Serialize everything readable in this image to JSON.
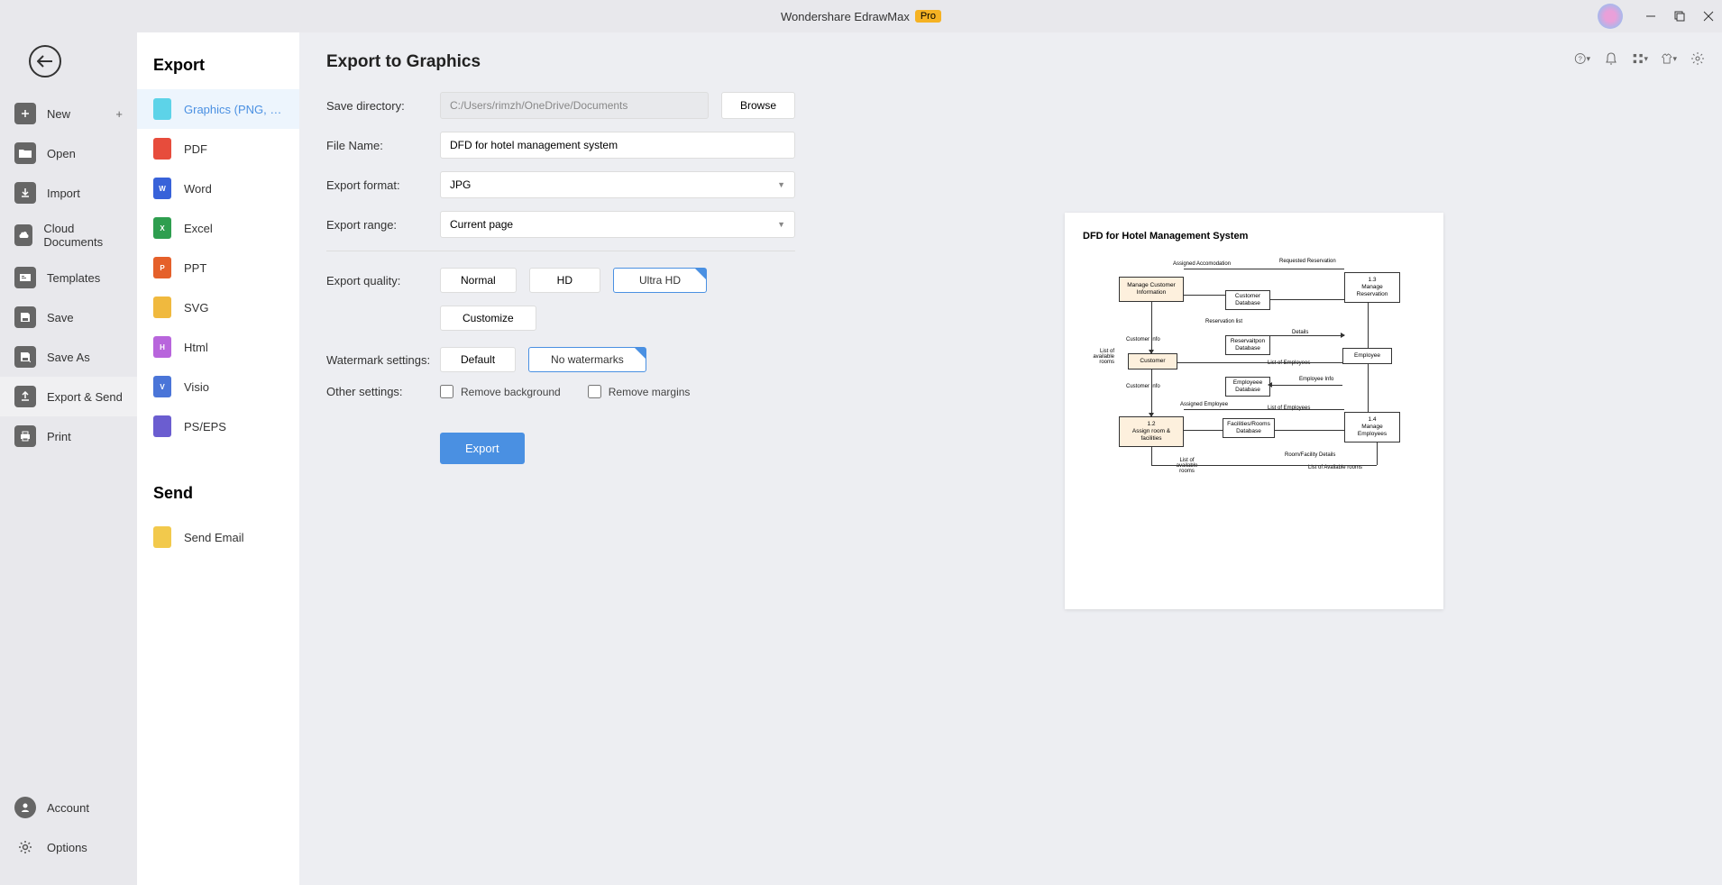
{
  "app": {
    "title": "Wondershare EdrawMax",
    "badge": "Pro"
  },
  "sidebar": {
    "items": [
      {
        "label": "New"
      },
      {
        "label": "Open"
      },
      {
        "label": "Import"
      },
      {
        "label": "Cloud Documents"
      },
      {
        "label": "Templates"
      },
      {
        "label": "Save"
      },
      {
        "label": "Save As"
      },
      {
        "label": "Export & Send"
      },
      {
        "label": "Print"
      }
    ],
    "bottom": [
      {
        "label": "Account"
      },
      {
        "label": "Options"
      }
    ]
  },
  "options_panel": {
    "export_heading": "Export",
    "export_items": [
      {
        "label": "Graphics (PNG, JPG et...",
        "color": "#5dd3e8"
      },
      {
        "label": "PDF",
        "color": "#e74c3c"
      },
      {
        "label": "Word",
        "color": "#3862d9"
      },
      {
        "label": "Excel",
        "color": "#2e9e4f"
      },
      {
        "label": "PPT",
        "color": "#e5602a"
      },
      {
        "label": "SVG",
        "color": "#f0b93e"
      },
      {
        "label": "Html",
        "color": "#b865dc"
      },
      {
        "label": "Visio",
        "color": "#4a75d8"
      },
      {
        "label": "PS/EPS",
        "color": "#6b5dd0"
      }
    ],
    "send_heading": "Send",
    "send_items": [
      {
        "label": "Send Email",
        "color": "#f2c94c"
      }
    ]
  },
  "form": {
    "title": "Export to Graphics",
    "save_dir_label": "Save directory:",
    "save_dir_value": "C:/Users/rimzh/OneDrive/Documents",
    "browse_label": "Browse",
    "filename_label": "File Name:",
    "filename_value": "DFD for hotel management system",
    "format_label": "Export format:",
    "format_value": "JPG",
    "range_label": "Export range:",
    "range_value": "Current page",
    "quality_label": "Export quality:",
    "quality_options": [
      "Normal",
      "HD",
      "Ultra HD"
    ],
    "customize_label": "Customize",
    "watermark_label": "Watermark settings:",
    "watermark_options": [
      "Default",
      "No watermarks"
    ],
    "other_label": "Other settings:",
    "remove_bg_label": "Remove background",
    "remove_margins_label": "Remove margins",
    "export_btn": "Export"
  },
  "preview": {
    "title": "DFD for Hotel Management System",
    "boxes": {
      "mci": "Manage Customer\nInformation",
      "p13": "1.3",
      "mr": "Manage\nReservation",
      "cd": "Customer\nDatabase",
      "rd": "Reservaitpon\nDatabase",
      "cust": "Customer",
      "emp": "Employee",
      "ed": "Employeee\nDatabase",
      "p12": "1.2",
      "arf": "Assign room &\nfacilities",
      "frd": "Facilities/Rooms\nDatabase",
      "p14": "1.4",
      "me": "Manage\nEmployees"
    },
    "labels": {
      "aa": "Assigned Accomodation",
      "rr": "Requested Reservation",
      "rl": "Reservation list",
      "ci1": "Customer Info",
      "ci2": "Customer Info",
      "det": "Details",
      "loe1": "List of Employees",
      "loe2": "List of Employees",
      "ei": "Employee Info",
      "ae": "Assigned Employee",
      "rfd": "Room/Facility Details",
      "loar": "List of Available rooms",
      "loar2": "List of\navailable\nrooms",
      "loar3": "List of\navailable\nrooms"
    }
  }
}
